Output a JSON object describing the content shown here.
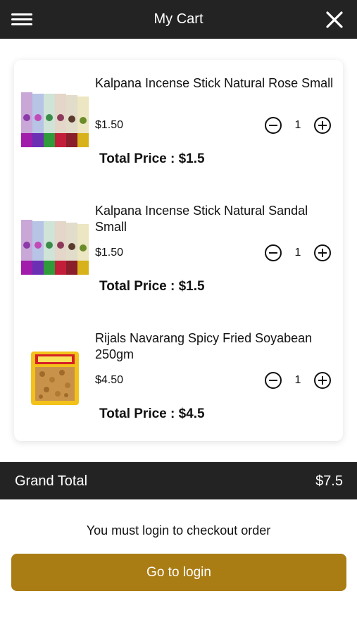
{
  "header": {
    "title": "My Cart",
    "menu_icon": "hamburger-menu-icon",
    "close_icon": "close-icon"
  },
  "cart": {
    "items": [
      {
        "name": "Kalpana Incense Stick Natural Rose Small",
        "price": "$1.50",
        "quantity": "1",
        "total_price": "Total Price : $1.5",
        "image": "incense-stick-box-image"
      },
      {
        "name": "Kalpana Incense Stick Natural Sandal Small",
        "price": "$1.50",
        "quantity": "1",
        "total_price": "Total Price : $1.5",
        "image": "incense-stick-box-image"
      },
      {
        "name": "Rijals Navarang Spicy Fried Soyabean 250gm",
        "price": "$4.50",
        "quantity": "1",
        "total_price": "Total Price : $4.5",
        "image": "soyabean-snack-packet-image"
      }
    ]
  },
  "grand_total": {
    "label": "Grand Total",
    "value": "$7.5"
  },
  "checkout": {
    "message": "You must login to checkout order",
    "button_label": "Go to login"
  },
  "colors": {
    "bar": "#232323",
    "accent": "#a97c14",
    "background": "#ffffff"
  }
}
